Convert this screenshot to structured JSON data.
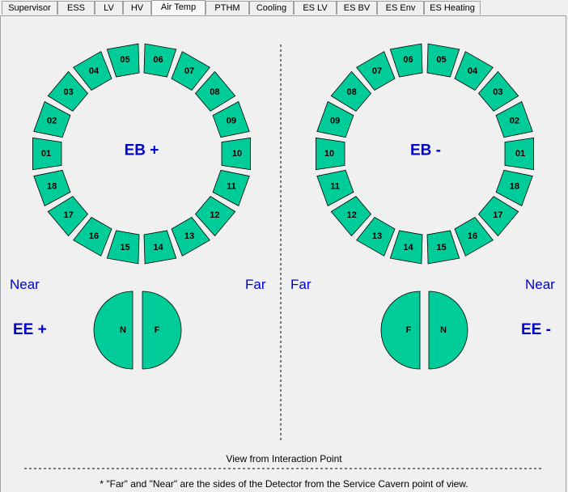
{
  "tabs": [
    {
      "label": "Supervisor",
      "active": false
    },
    {
      "label": "ESS",
      "active": false
    },
    {
      "label": "LV",
      "active": false
    },
    {
      "label": "HV",
      "active": false
    },
    {
      "label": "Air Temp",
      "active": true
    },
    {
      "label": "PTHM",
      "active": false
    },
    {
      "label": "Cooling",
      "active": false
    },
    {
      "label": "ES LV",
      "active": false
    },
    {
      "label": "ES BV",
      "active": false
    },
    {
      "label": "ES Env",
      "active": false
    },
    {
      "label": "ES Heating",
      "active": false
    }
  ],
  "colors": {
    "segment": "#00cc99",
    "label_blue": "#0000cc"
  },
  "barrel_plus": {
    "title": "EB +",
    "segments": [
      "01",
      "02",
      "03",
      "04",
      "05",
      "06",
      "07",
      "08",
      "09",
      "10",
      "11",
      "12",
      "13",
      "14",
      "15",
      "16",
      "17",
      "18"
    ]
  },
  "barrel_minus": {
    "title": "EB -",
    "segments": [
      "01",
      "02",
      "03",
      "04",
      "05",
      "06",
      "07",
      "08",
      "09",
      "10",
      "11",
      "12",
      "13",
      "14",
      "15",
      "16",
      "17",
      "18"
    ]
  },
  "left_side": {
    "near": "Near",
    "far": "Far",
    "ee_label": "EE +",
    "half_left": "N",
    "half_right": "F"
  },
  "right_side": {
    "far": "Far",
    "near": "Near",
    "ee_label": "EE -",
    "half_left": "F",
    "half_right": "N"
  },
  "footer": {
    "view_label": "View from Interaction Point",
    "note": "*  \"Far\" and \"Near\" are the sides of the Detector from the Service Cavern point of view."
  }
}
